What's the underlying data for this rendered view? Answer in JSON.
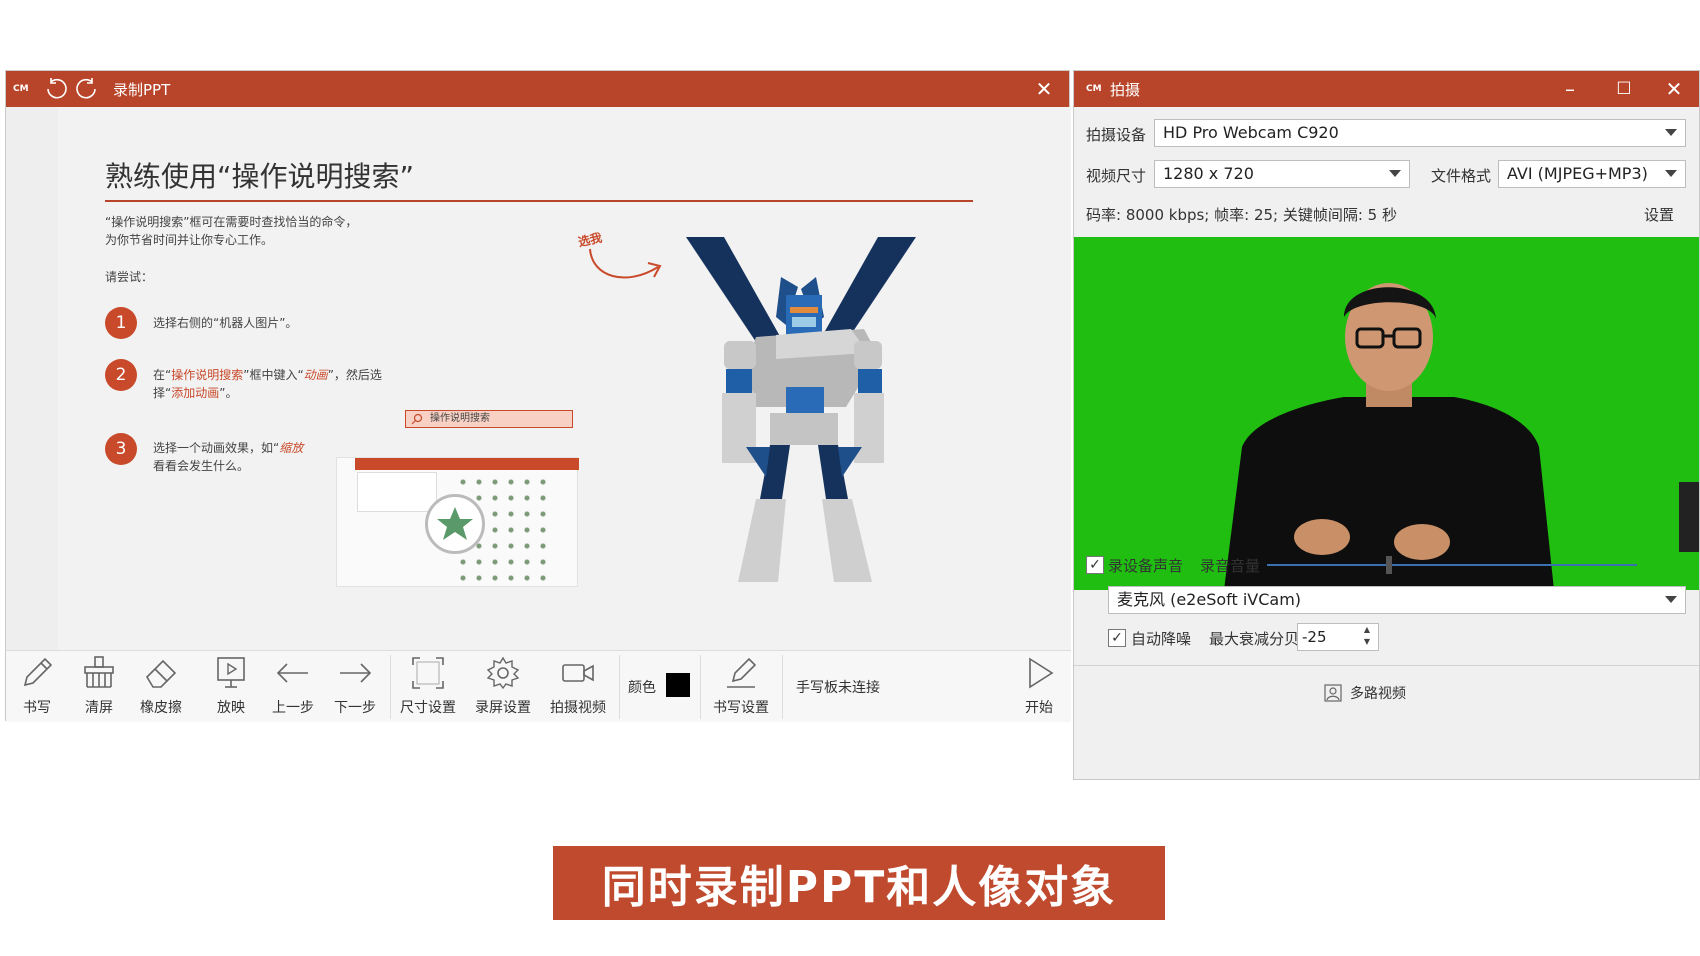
{
  "left_window": {
    "title": "录制PPT",
    "logo": "CM",
    "close": "✕",
    "slide": {
      "title": "熟练使用“操作说明搜索”",
      "intro": "“操作说明搜索”框可在需要时查找恰当的命令，\n为你节省时间并让你专心工作。",
      "try_label": "请尝试：",
      "hint": "选我",
      "step1_num": "1",
      "step1_text": "选择右侧的“机器人图片”。",
      "step2_num": "2",
      "step2_pre": "在“",
      "step2_search": "操作说明搜索",
      "step2_mid": "”框中键入“",
      "step2_anim": "动画",
      "step2_post": "”，然后选",
      "step2_line2_pre": "择“",
      "step2_add": "添加动画",
      "step2_line2_post": "”。",
      "search_box": "操作说明搜索",
      "step3_num": "3",
      "step3_pre": "选择一个动画效果，如“",
      "step3_zoom": "缩放",
      "step3_line2": "看看会发生什么。"
    },
    "toolbar": {
      "write": "书写",
      "clear": "清屏",
      "eraser": "橡皮擦",
      "present": "放映",
      "prev": "上一步",
      "next": "下一步",
      "size": "尺寸设置",
      "rec_settings": "录屏设置",
      "capture_video": "拍摄视频",
      "color_label": "颜色",
      "color_value": "#000000",
      "pen_settings": "书写设置",
      "tablet_status": "手写板未连接",
      "start": "开始"
    }
  },
  "right_window": {
    "title": "拍摄",
    "logo": "CM",
    "minimize": "–",
    "maximize": "☐",
    "close": "✕",
    "device_label": "拍摄设备",
    "device_value": "HD Pro Webcam C920",
    "size_label": "视频尺寸",
    "size_value": "1280 x 720",
    "format_label": "文件格式",
    "format_value": "AVI (MJPEG+MP3)",
    "stats": "码率: 8000 kbps; 帧率: 25; 关键帧间隔: 5 秒",
    "settings_link": "设置",
    "record_audio_label": "录设备声音",
    "record_audio_checked": true,
    "volume_label": "录音音量",
    "volume_level": 0.33,
    "mic_value": "麦克风 (e2eSoft iVCam)",
    "denoise_label": "自动降噪",
    "denoise_checked": true,
    "max_db_label": "最大衰减分贝",
    "max_db_value": "-25",
    "multi_video": "多路视频"
  },
  "banner": {
    "text": "同时录制PPT和人像对象",
    "color": "#c04a2e"
  },
  "colors": {
    "accent": "#b8452a",
    "green_screen": "#1fbe10"
  }
}
